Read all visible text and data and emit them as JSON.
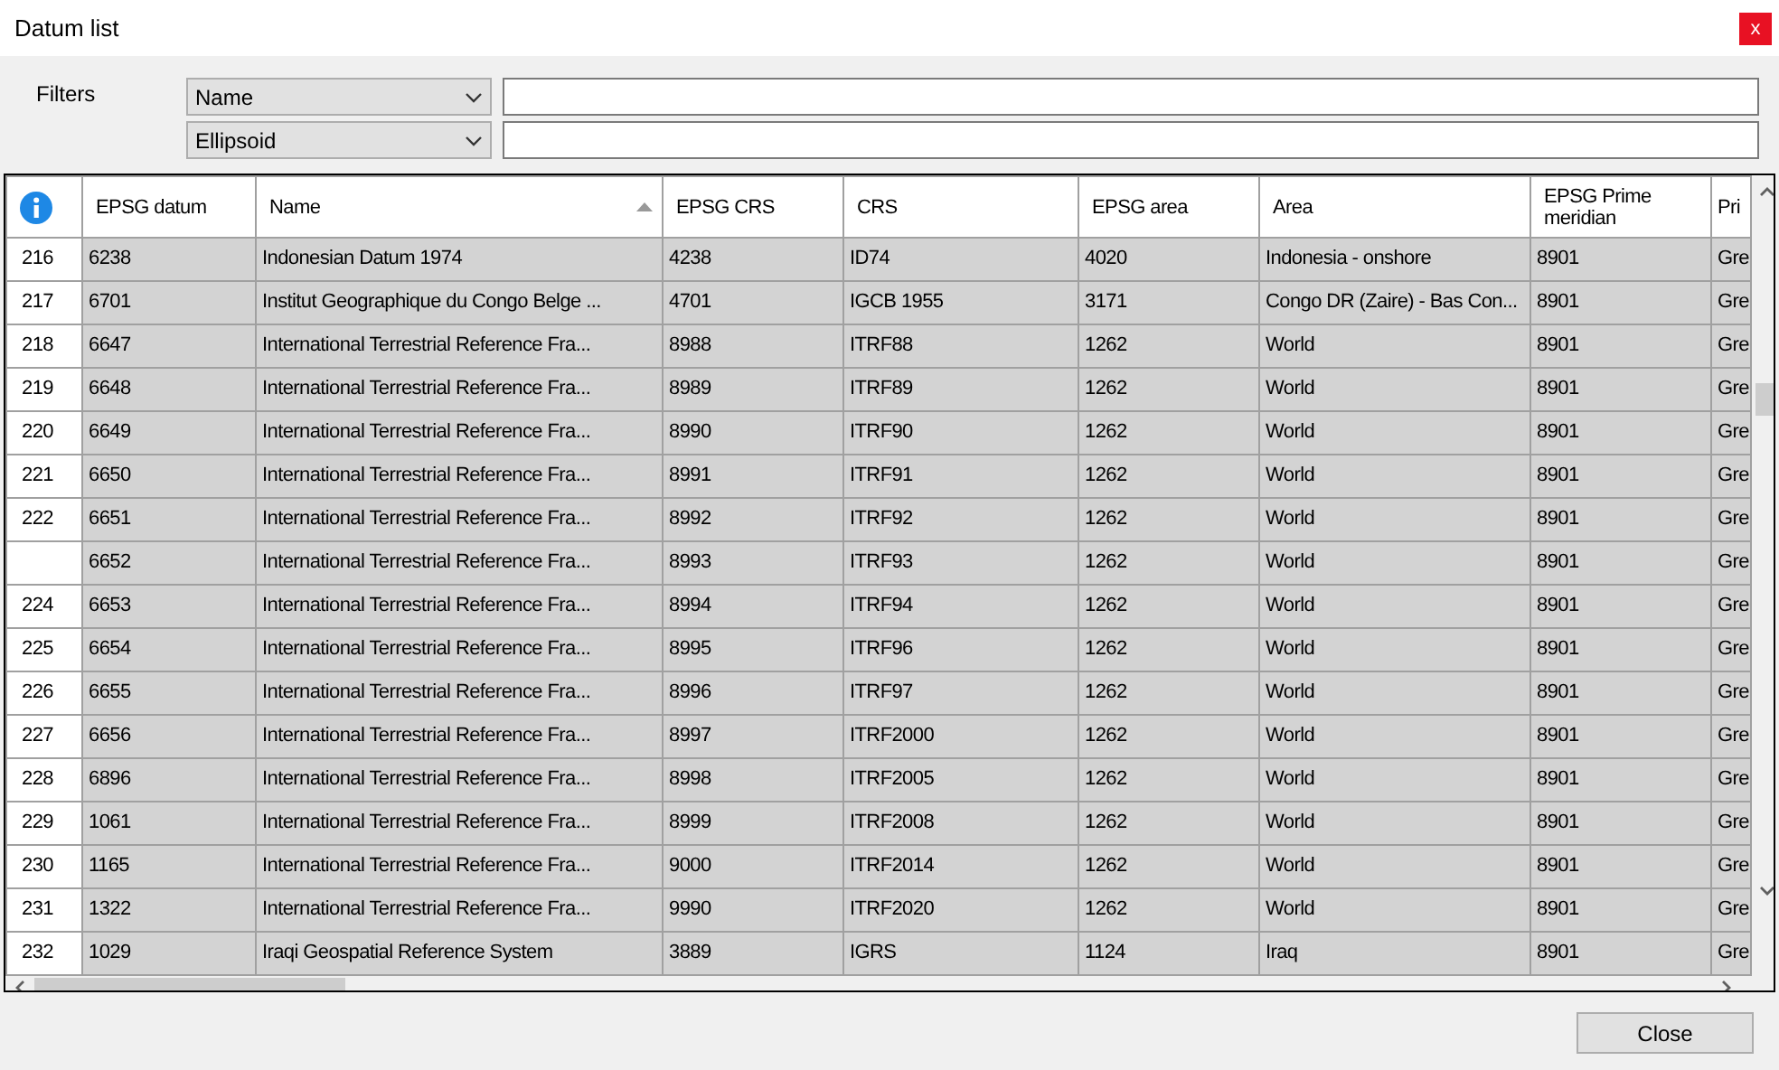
{
  "window": {
    "title": "Datum list",
    "close_label": "x"
  },
  "filters": {
    "label": "Filters",
    "rows": [
      {
        "field": "Name"
      },
      {
        "field": "Ellipsoid"
      }
    ]
  },
  "table": {
    "columns": [
      {
        "label": "EPSG datum",
        "sorted": false
      },
      {
        "label": "Name",
        "sorted": true
      },
      {
        "label": "EPSG CRS",
        "sorted": false
      },
      {
        "label": "CRS",
        "sorted": false
      },
      {
        "label": "EPSG area",
        "sorted": false
      },
      {
        "label": "Area",
        "sorted": false
      },
      {
        "label": "EPSG Prime meridian",
        "sorted": false
      },
      {
        "label": "Pri",
        "sorted": false
      }
    ],
    "rows": [
      {
        "row_number": "216",
        "cells": [
          "6238",
          "Indonesian Datum 1974",
          "4238",
          "ID74",
          "4020",
          "Indonesia - onshore",
          "8901",
          "Gre"
        ]
      },
      {
        "row_number": "217",
        "cells": [
          "6701",
          "Institut Geographique du Congo Belge ...",
          "4701",
          "IGCB 1955",
          "3171",
          "Congo DR (Zaire) - Bas Con...",
          "8901",
          "Gre"
        ]
      },
      {
        "row_number": "218",
        "cells": [
          "6647",
          "International Terrestrial Reference Fra...",
          "8988",
          "ITRF88",
          "1262",
          "World",
          "8901",
          "Gre"
        ]
      },
      {
        "row_number": "219",
        "cells": [
          "6648",
          "International Terrestrial Reference Fra...",
          "8989",
          "ITRF89",
          "1262",
          "World",
          "8901",
          "Gre"
        ]
      },
      {
        "row_number": "220",
        "cells": [
          "6649",
          "International Terrestrial Reference Fra...",
          "8990",
          "ITRF90",
          "1262",
          "World",
          "8901",
          "Gre"
        ]
      },
      {
        "row_number": "221",
        "cells": [
          "6650",
          "International Terrestrial Reference Fra...",
          "8991",
          "ITRF91",
          "1262",
          "World",
          "8901",
          "Gre"
        ]
      },
      {
        "row_number": "222",
        "cells": [
          "6651",
          "International Terrestrial Reference Fra...",
          "8992",
          "ITRF92",
          "1262",
          "World",
          "8901",
          "Gre"
        ]
      },
      {
        "cells": [
          "6652",
          "International Terrestrial Reference Fra...",
          "8993",
          "ITRF93",
          "1262",
          "World",
          "8901",
          "Gre"
        ]
      },
      {
        "row_number": "224",
        "cells": [
          "6653",
          "International Terrestrial Reference Fra...",
          "8994",
          "ITRF94",
          "1262",
          "World",
          "8901",
          "Gre"
        ]
      },
      {
        "row_number": "225",
        "cells": [
          "6654",
          "International Terrestrial Reference Fra...",
          "8995",
          "ITRF96",
          "1262",
          "World",
          "8901",
          "Gre"
        ]
      },
      {
        "row_number": "226",
        "cells": [
          "6655",
          "International Terrestrial Reference Fra...",
          "8996",
          "ITRF97",
          "1262",
          "World",
          "8901",
          "Gre"
        ]
      },
      {
        "row_number": "227",
        "cells": [
          "6656",
          "International Terrestrial Reference Fra...",
          "8997",
          "ITRF2000",
          "1262",
          "World",
          "8901",
          "Gre"
        ]
      },
      {
        "row_number": "228",
        "cells": [
          "6896",
          "International Terrestrial Reference Fra...",
          "8998",
          "ITRF2005",
          "1262",
          "World",
          "8901",
          "Gre"
        ]
      },
      {
        "row_number": "229",
        "cells": [
          "1061",
          "International Terrestrial Reference Fra...",
          "8999",
          "ITRF2008",
          "1262",
          "World",
          "8901",
          "Gre"
        ]
      },
      {
        "row_number": "230",
        "cells": [
          "1165",
          "International Terrestrial Reference Fra...",
          "9000",
          "ITRF2014",
          "1262",
          "World",
          "8901",
          "Gre"
        ]
      },
      {
        "row_number": "231",
        "cells": [
          "1322",
          "International Terrestrial Reference Fra...",
          "9990",
          "ITRF2020",
          "1262",
          "World",
          "8901",
          "Gre"
        ]
      },
      {
        "row_number": "232",
        "cells": [
          "1029",
          "Iraqi Geospatial Reference System",
          "3889",
          "IGRS",
          "1124",
          "Iraq",
          "8901",
          "Gre"
        ]
      }
    ]
  },
  "buttons": [
    {
      "label": "Close"
    }
  ]
}
